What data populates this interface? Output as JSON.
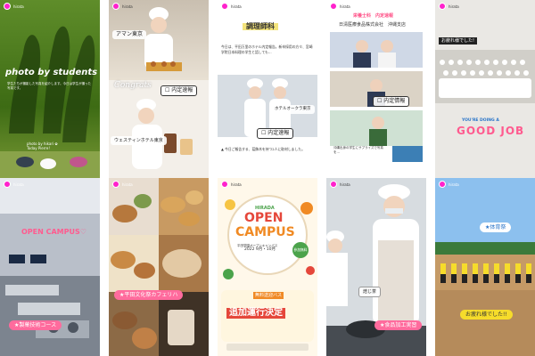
{
  "colors": {
    "pink": "#ff5b8f",
    "orange": "#f08a24",
    "green": "#4ba34b",
    "blue": "#2a75c9",
    "black": "#1b1b1b"
  },
  "tiles": {
    "t1": {
      "title": "photo by students",
      "photo_credit": "photo by hikari ✿",
      "caption": "Today Pierre!"
    },
    "t2": {
      "company1": "アマン東京",
      "congrats": "Congrats",
      "naitei": "内定速報",
      "company2": "ウェスティンホテル東京"
    },
    "t3": {
      "header": "調理師科",
      "lead": "今日は、平田万里のホテル内定報告。新卒採用の方々、宮崎学院日本料理の学生と話しても…",
      "label1": "ホテルオークラ東京",
      "label2": "内定速報"
    },
    "t4": {
      "header": "日清医療食品株式会社　沖縄支店",
      "naitei": "内定情報",
      "footer": "沖縄出身の学生にサプライズで写真を…",
      "top_tag": "栄養士科　内定速報"
    },
    "t5": {
      "banner": "お疲れ様でした!",
      "good_job_small": "YOU'RE DOING A",
      "good_job": "GOOD JOB"
    },
    "t6": {
      "open": "OPEN CAMPUS♡",
      "caption": "★製菓技術コース"
    },
    "t7": {
      "caption": "★平田文化祭カフェリハ"
    },
    "t8": {
      "brand": "HIRADA",
      "open": "OPEN",
      "campus": "CAMPUS",
      "date_line": "2022 9月・10月",
      "badge": "無料送迎バス",
      "bus": "追加運行決定",
      "dot_text": "参加無料",
      "top_small": "平田学園オープンキャンパス"
    },
    "t9": {
      "tag": "焙じ茶",
      "caption": "★食品加工実習"
    },
    "t10": {
      "top": "★体育祭",
      "caption": "お疲れ様でした!!"
    }
  }
}
